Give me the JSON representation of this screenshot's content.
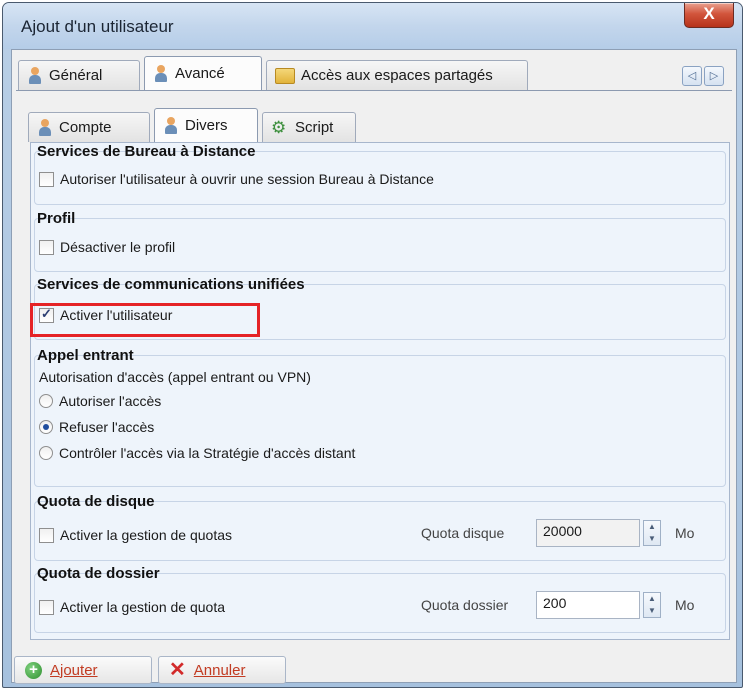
{
  "window": {
    "title": "Ajout d'un utilisateur",
    "close_glyph": "X"
  },
  "tabs": [
    {
      "label": "Général",
      "icon": "user-icon"
    },
    {
      "label": "Avancé",
      "icon": "user-icon"
    },
    {
      "label": "Accès aux espaces partagés",
      "icon": "folder-icon"
    }
  ],
  "subtabs": [
    {
      "label": "Compte",
      "icon": "user-icon"
    },
    {
      "label": "Divers",
      "icon": "user-icon"
    },
    {
      "label": "Script",
      "icon": "gear-icon"
    }
  ],
  "nav": {
    "prev": "◁",
    "next": "▷"
  },
  "groups": {
    "rds": {
      "title": "Services de Bureau à Distance",
      "checkbox_label": "Autoriser l'utilisateur à ouvrir une session Bureau à Distance",
      "checked": false
    },
    "profil": {
      "title": "Profil",
      "checkbox_label": "Désactiver le profil",
      "checked": false
    },
    "ucs": {
      "title": "Services de communications unifiées",
      "checkbox_label": "Activer l'utilisateur",
      "checked": true
    },
    "appel": {
      "title": "Appel entrant",
      "subtitle": "Autorisation d'accès (appel entrant ou VPN)",
      "options": [
        {
          "label": "Autoriser l'accès",
          "selected": false
        },
        {
          "label": "Refuser l'accès",
          "selected": true
        },
        {
          "label": "Contrôler l'accès via la Stratégie d'accès distant",
          "selected": false
        }
      ]
    },
    "quota_disque": {
      "title": "Quota de disque",
      "checkbox_label": "Activer la gestion de quotas",
      "checked": false,
      "field_label": "Quota disque",
      "value": "20000",
      "unit": "Mo"
    },
    "quota_dossier": {
      "title": "Quota de dossier",
      "checkbox_label": "Activer la gestion de quota",
      "checked": false,
      "field_label": "Quota dossier",
      "value": "200",
      "unit": "Mo"
    }
  },
  "footer": {
    "add_label": "Ajouter",
    "cancel_label": "Annuler"
  },
  "colors": {
    "highlight": "#e52326",
    "accent": "#1f4d9e"
  }
}
